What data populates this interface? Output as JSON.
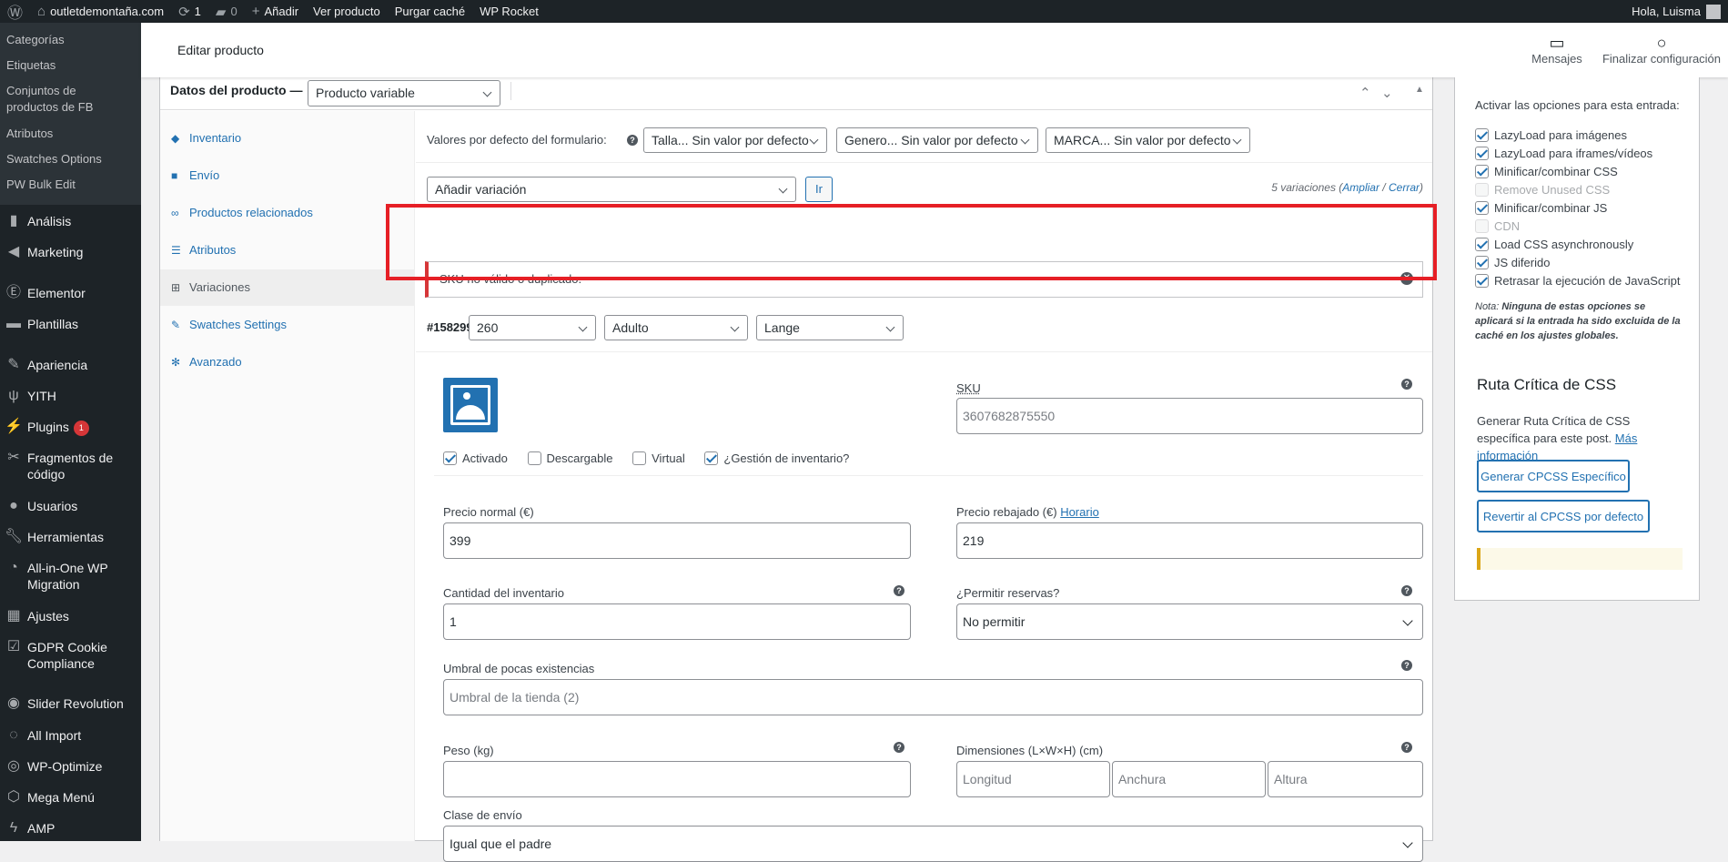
{
  "adminbar": {
    "site_name": "outletdemontaña.com",
    "updates_count": "1",
    "comments_count": "0",
    "add_label": "Añadir",
    "view_product": "Ver producto",
    "purge_cache": "Purgar caché",
    "wp_rocket": "WP Rocket",
    "greeting": "Hola, Luisma"
  },
  "sidebar": {
    "submenu": [
      "Categorías",
      "Etiquetas",
      "Conjuntos de productos de FB",
      "Atributos",
      "Swatches Options",
      "PW Bulk Edit"
    ],
    "menu": [
      {
        "label": "Análisis",
        "icon": "chart-bar-icon"
      },
      {
        "label": "Marketing",
        "icon": "megaphone-icon"
      },
      {
        "label": "Elementor",
        "icon": "elementor-icon"
      },
      {
        "label": "Plantillas",
        "icon": "folder-icon"
      },
      {
        "label": "Apariencia",
        "icon": "paintbrush-icon"
      },
      {
        "label": "YITH",
        "icon": "yith-icon"
      },
      {
        "label": "Plugins",
        "icon": "plugin-icon",
        "badge": "1"
      },
      {
        "label": "Fragmentos de código",
        "icon": "scissors-icon"
      },
      {
        "label": "Usuarios",
        "icon": "user-icon"
      },
      {
        "label": "Herramientas",
        "icon": "wrench-icon"
      },
      {
        "label": "All-in-One WP Migration",
        "icon": "migration-icon"
      },
      {
        "label": "Ajustes",
        "icon": "settings-icon"
      },
      {
        "label": "GDPR Cookie Compliance",
        "icon": "checkbox-icon"
      },
      {
        "label": "Slider Revolution",
        "icon": "slider-icon"
      },
      {
        "label": "All Import",
        "icon": "import-icon"
      },
      {
        "label": "WP-Optimize",
        "icon": "optimize-icon"
      },
      {
        "label": "Mega Menú",
        "icon": "megamenu-icon"
      },
      {
        "label": "AMP",
        "icon": "amp-icon"
      }
    ]
  },
  "topbar": {
    "title": "Editar producto",
    "messages": "Mensajes",
    "finish_setup": "Finalizar configuración"
  },
  "product": {
    "title": "Datos del producto —",
    "type": "Producto variable",
    "tabs": [
      "Inventario",
      "Envío",
      "Productos relacionados",
      "Atributos",
      "Variaciones",
      "Swatches Settings",
      "Avanzado"
    ],
    "defaults_label": "Valores por defecto del formulario:",
    "default_selects": [
      "Talla... Sin valor por defecto",
      "Genero... Sin valor por defecto",
      "MARCA... Sin valor por defecto"
    ],
    "add_variation": "Añadir variación",
    "go": "Ir",
    "variations_count": "5 variaciones (",
    "expand": "Ampliar",
    "sep": " / ",
    "close": "Cerrar",
    "paren_close": ")",
    "notice": "SKU no válido o duplicado."
  },
  "variation": {
    "id": "#158299",
    "attr_values": [
      "260",
      "Adulto",
      "Lange"
    ],
    "sku_label": "SKU",
    "sku": "3607682875550",
    "checks": [
      {
        "label": "Activado",
        "checked": true
      },
      {
        "label": "Descargable",
        "checked": false
      },
      {
        "label": "Virtual",
        "checked": false
      },
      {
        "label": "¿Gestión de inventario?",
        "checked": true
      }
    ],
    "regular_price_label": "Precio normal (€)",
    "regular_price": "399",
    "sale_price_label": "Precio rebajado (€)",
    "schedule": "Horario",
    "sale_price": "219",
    "stock_qty_label": "Cantidad del inventario",
    "stock_qty": "1",
    "backorders_label": "¿Permitir reservas?",
    "backorders": "No permitir",
    "low_stock_label": "Umbral de pocas existencias",
    "low_stock_placeholder": "Umbral de la tienda (2)",
    "weight_label": "Peso (kg)",
    "dimensions_label": "Dimensiones (L×W×H) (cm)",
    "length_ph": "Longitud",
    "width_ph": "Anchura",
    "height_ph": "Altura",
    "shipping_class_label": "Clase de envío",
    "shipping_class": "Igual que el padre"
  },
  "rocket": {
    "intro": "Activar las opciones para esta entrada:",
    "options": [
      {
        "label": "LazyLoad para imágenes",
        "checked": true,
        "disabled": false
      },
      {
        "label": "LazyLoad para iframes/vídeos",
        "checked": true,
        "disabled": false
      },
      {
        "label": "Minificar/combinar CSS",
        "checked": true,
        "disabled": false
      },
      {
        "label": "Remove Unused CSS",
        "checked": false,
        "disabled": true
      },
      {
        "label": "Minificar/combinar JS",
        "checked": true,
        "disabled": false
      },
      {
        "label": "CDN",
        "checked": false,
        "disabled": true
      },
      {
        "label": "Load CSS asynchronously",
        "checked": true,
        "disabled": false
      },
      {
        "label": "JS diferido",
        "checked": true,
        "disabled": false
      },
      {
        "label": "Retrasar la ejecución de JavaScript",
        "checked": true,
        "disabled": false
      }
    ],
    "note_prefix": "Nota:",
    "note": "Ninguna de estas opciones se aplicará si la entrada ha sido excluida de la caché en los ajustes globales.",
    "cpcss_title": "Ruta Crítica de CSS",
    "cpcss_text": "Generar Ruta Crítica de CSS específica para este post.",
    "more_info": "Más información",
    "generate_btn": "Generar CPCSS Específico",
    "revert_btn": "Revertir al CPCSS por defecto"
  }
}
